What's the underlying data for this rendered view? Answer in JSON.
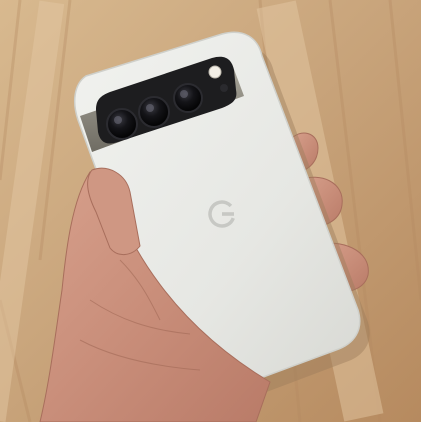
{
  "photo": {
    "subject": "hand-holding-phone",
    "phone_color": "#e9eae6",
    "camera_bar_color": "#1d1d1f",
    "frame_color": "#8d8a80",
    "wood_color": "#c9a57c"
  },
  "phone": {
    "logo_letter": "G"
  }
}
